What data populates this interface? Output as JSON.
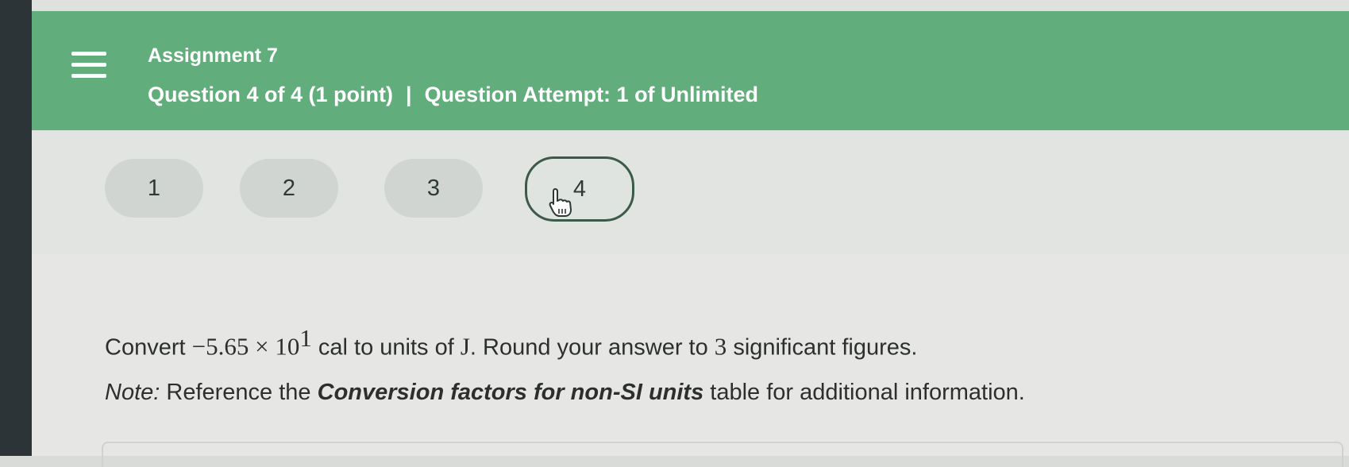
{
  "header": {
    "assignment_title": "Assignment 7",
    "question_position": "Question 4 of 4 (1 point)",
    "separator": "|",
    "attempt_info": "Question Attempt: 1 of Unlimited"
  },
  "question_nav": {
    "buttons": [
      "1",
      "2",
      "3",
      "4"
    ],
    "current": "4"
  },
  "question": {
    "prefix": "Convert ",
    "value": "−5.65 × 10",
    "exponent": "1",
    "unit_from": "cal",
    "mid": " to units of ",
    "unit_to": "J",
    "suffix": ". Round your answer to ",
    "sig_figs": "3",
    "end": " significant figures."
  },
  "note": {
    "label": "Note:",
    "pre": " Reference the ",
    "link": "Conversion factors for non-SI units",
    "post": " table for additional information."
  },
  "icons": {
    "menu": "hamburger-menu-icon",
    "cursor": "hand-pointer-icon"
  },
  "colors": {
    "header_bg": "#62ad7c",
    "current_border": "#3b5a49"
  }
}
